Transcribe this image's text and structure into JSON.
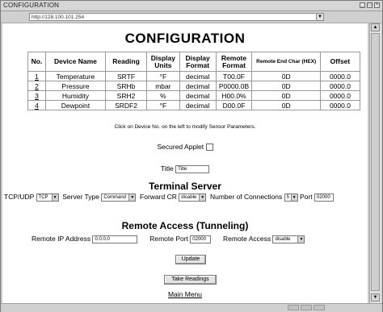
{
  "window": {
    "title": "CONFIGURATION"
  },
  "address_bar": {
    "url": "http://128.100.101.254"
  },
  "page": {
    "title": "CONFIGURATION"
  },
  "sensor_table": {
    "headers": [
      "No.",
      "Device Name",
      "Reading",
      "Display Units",
      "Display Format",
      "Remote Format",
      "Remote End Char (HEX)",
      "Offset"
    ],
    "rows": [
      {
        "no": "1",
        "device_name": "Temperature",
        "reading": "SRTF",
        "display_units": "°F",
        "display_format": "decimal",
        "remote_format": "T00.0F",
        "remote_end_char": "0D",
        "offset": "0000.0"
      },
      {
        "no": "2",
        "device_name": "Pressure",
        "reading": "SRHb",
        "display_units": "mbar",
        "display_format": "decimal",
        "remote_format": "P0000.0B",
        "remote_end_char": "0D",
        "offset": "0000.0"
      },
      {
        "no": "3",
        "device_name": "Humidity",
        "reading": "SRH2",
        "display_units": "%",
        "display_format": "decimal",
        "remote_format": "H00.0%",
        "remote_end_char": "0D",
        "offset": "0000.0"
      },
      {
        "no": "4",
        "device_name": "Dewpoint",
        "reading": "SRDF2",
        "display_units": "°F",
        "display_format": "decimal",
        "remote_format": "D00.0F",
        "remote_end_char": "0D",
        "offset": "0000.0"
      }
    ]
  },
  "hint": "Click on Device No. on the left to modify Sensor Parameters.",
  "secured_applet": {
    "label": "Secured Applet",
    "checked": false
  },
  "title_field": {
    "label": "Title",
    "value": "Title"
  },
  "terminal_server": {
    "heading": "Terminal Server",
    "protocol_label": "TCP/UDP",
    "protocol_value": "TCP",
    "server_type_label": "Server Type",
    "server_type_value": "Command",
    "forward_cr_label": "Forward CR",
    "forward_cr_value": "disable",
    "connections_label": "Number of Connections",
    "connections_value": "5",
    "port_label": "Port",
    "port_value": "02000"
  },
  "remote_access": {
    "heading": "Remote Access (Tunneling)",
    "ip_label": "Remote IP Address",
    "ip_value": "0.0.0.0",
    "port_label": "Remote Port",
    "port_value": "02000",
    "access_label": "Remote Access",
    "access_value": "disable"
  },
  "buttons": {
    "update": "Update",
    "take_readings": "Take Readings"
  },
  "main_menu_link": "Main Menu",
  "icons": {
    "dropdown": "chevron-down-icon",
    "scroll_up": "arrow-up-icon",
    "scroll_down": "arrow-down-icon"
  }
}
